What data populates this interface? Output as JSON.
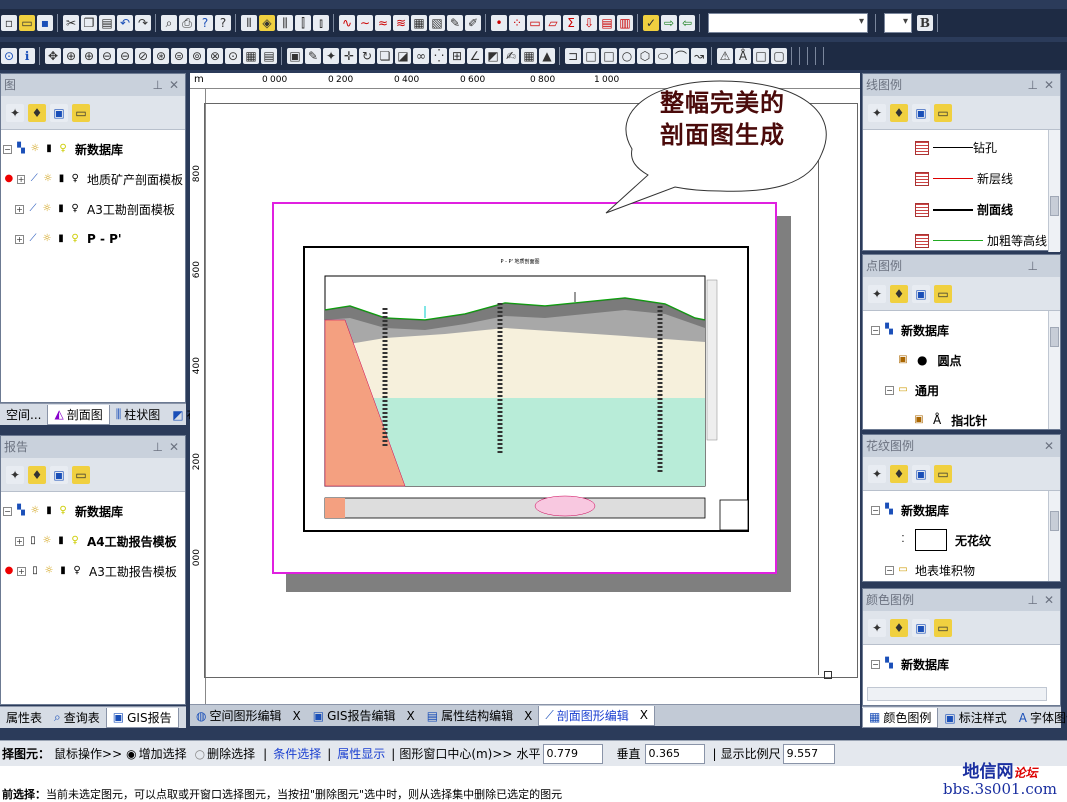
{
  "toolbar": {
    "font_bold_label": "B"
  },
  "left_panels": {
    "map_panel": {
      "title": "图",
      "root_label": "新数据库",
      "items": [
        "地质矿产剖面模板",
        "A3工勘剖面模板",
        "P - P'"
      ]
    },
    "map_tabs": [
      "空间...",
      "剖面图",
      "柱状图",
      "布局"
    ],
    "report_panel": {
      "title": "报告",
      "root_label": "新数据库",
      "items": [
        "A4工勘报告模板",
        "A3工勘报告模板"
      ]
    },
    "bottom_tabs": [
      "属性表",
      "查询表",
      "GIS报告"
    ]
  },
  "doc_tabs": [
    {
      "label": "空间图形编辑",
      "close": "X"
    },
    {
      "label": "GIS报告编辑",
      "close": "X"
    },
    {
      "label": "属性结构编辑",
      "close": "X"
    },
    {
      "label": "剖面图形编辑",
      "close": "X"
    }
  ],
  "canvas": {
    "ruler_top": [
      "m",
      "0",
      "000",
      "0",
      "200",
      "0",
      "400",
      "0",
      "600",
      "0",
      "800",
      "1",
      "000"
    ],
    "ruler_left": [
      "800",
      "600",
      "400",
      "200",
      "000"
    ],
    "callout_text_line1": "整幅完美的",
    "callout_text_line2": "剖面图生成",
    "drawing_title": "P - P' 地质剖面图"
  },
  "right_panels": {
    "line_legend": {
      "title": "线图例",
      "items": [
        "钻孔",
        "新层线",
        "剖面线",
        "加粗等高线"
      ]
    },
    "point_legend": {
      "title": "点图例",
      "root_label": "新数据库",
      "items": [
        "圆点",
        "通用",
        "指北针"
      ]
    },
    "pattern_legend": {
      "title": "花纹图例",
      "root_label": "新数据库",
      "items": [
        "无花纹",
        "地表堆积物"
      ]
    },
    "color_legend": {
      "title": "颜色图例",
      "root_label": "新数据库"
    },
    "tabs": [
      "颜色图例",
      "标注样式",
      "字体图例"
    ]
  },
  "status": {
    "select_label": "择图元：",
    "mouse_op": "鼠标操作>>",
    "add_select": "增加选择",
    "remove_select": "删除选择",
    "cond_select": "条件选择",
    "attr_show": "属性显示",
    "center_label": "图形窗口中心(m)>>",
    "h_label": "水平",
    "h_value": "0.779",
    "v_label": "垂直",
    "v_value": "0.365",
    "scale_label": "显示比例尺",
    "scale_value": "9.557",
    "current_label": "前选择：",
    "current_text": "当前未选定图元，可以点取或开窗口选择图元，当按扭\"删除图元\"选中时，则从选择集中删除已选定的图元"
  },
  "watermark": {
    "line1": "地信网",
    "line1b": "论坛",
    "line2": "bbs.3s001.com"
  }
}
